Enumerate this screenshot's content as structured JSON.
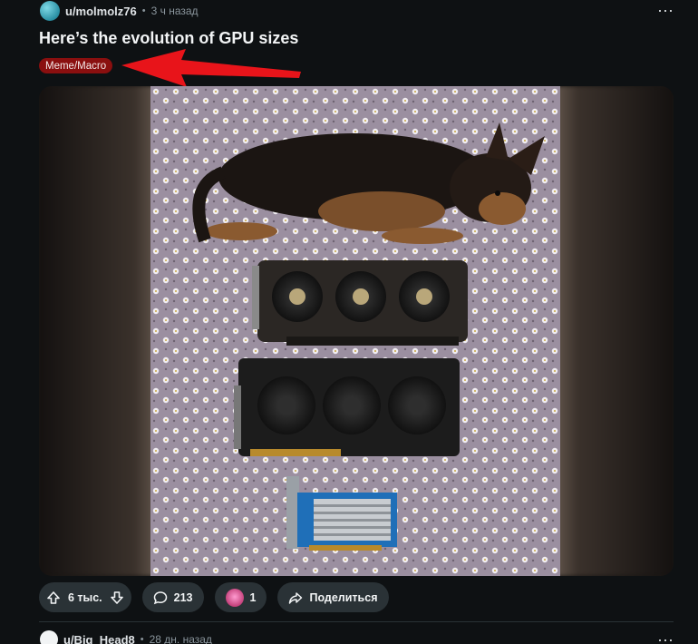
{
  "post": {
    "author": "u/molmolz76",
    "time": "3 ч назад",
    "title": "Here’s the evolution of GPU sizes",
    "flair": "Meme/Macro",
    "more_icon": "more-horizontal-icon",
    "flair_color": "#8a0f0f",
    "annotation_arrow_color": "#e8141a"
  },
  "actions": {
    "votes": "6 тыс.",
    "comments": "213",
    "awards": "1",
    "share": "Поделиться"
  },
  "next_post": {
    "author": "u/Big_Head8",
    "time": "28 дн. назад"
  }
}
